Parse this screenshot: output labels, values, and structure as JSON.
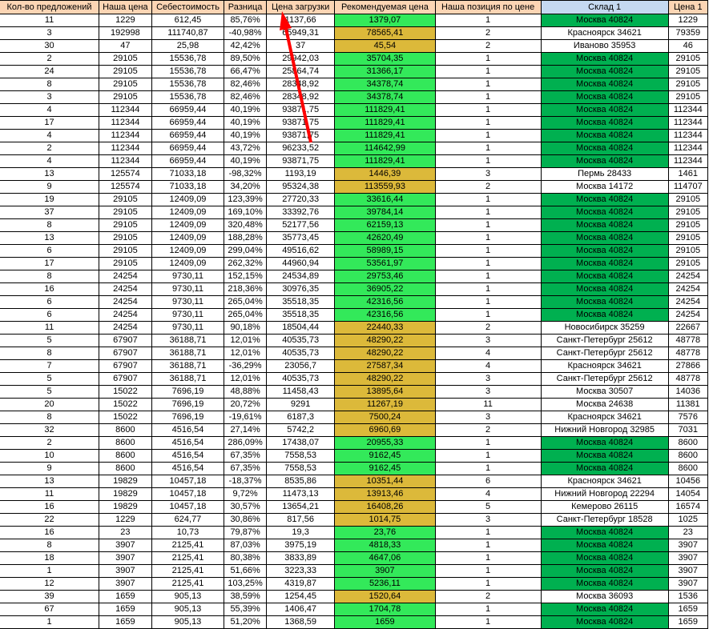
{
  "headers": [
    "Кол-во предложений",
    "Наша цена",
    "Себестоимость",
    "Разница",
    "Цена загрузки",
    "Рекомендуемая цена",
    "Наша позиция по цене",
    "Склад 1",
    "Цена 1"
  ],
  "colors": {
    "header": "#fcd5b4",
    "warehouse_header": "#c5d9f1",
    "recommended_ok": "#33e95a",
    "recommended_warn": "#dcb93a",
    "warehouse_ours": "#00b050",
    "arrow": "#ff0000"
  },
  "rows": [
    [
      "11",
      "1229",
      "612,45",
      "85,76%",
      "1137,66",
      "1379,07",
      "1",
      "Москва 40824",
      "1229"
    ],
    [
      "3",
      "192998",
      "111740,87",
      "-40,98%",
      "65949,31",
      "78565,41",
      "2",
      "Красноярск 34621",
      "79359"
    ],
    [
      "30",
      "47",
      "25,98",
      "42,42%",
      "37",
      "45,54",
      "2",
      "Иваново 35953",
      "46"
    ],
    [
      "2",
      "29105",
      "15536,78",
      "89,50%",
      "29942,03",
      "35704,35",
      "1",
      "Москва 40824",
      "29105"
    ],
    [
      "24",
      "29105",
      "15536,78",
      "66,47%",
      "25864,74",
      "31366,17",
      "1",
      "Москва 40824",
      "29105"
    ],
    [
      "8",
      "29105",
      "15536,78",
      "82,46%",
      "28348,92",
      "34378,74",
      "1",
      "Москва 40824",
      "29105"
    ],
    [
      "3",
      "29105",
      "15536,78",
      "82,46%",
      "28348,92",
      "34378,74",
      "1",
      "Москва 40824",
      "29105"
    ],
    [
      "4",
      "112344",
      "66959,44",
      "40,19%",
      "93871,75",
      "111829,41",
      "1",
      "Москва 40824",
      "112344"
    ],
    [
      "17",
      "112344",
      "66959,44",
      "40,19%",
      "93871,75",
      "111829,41",
      "1",
      "Москва 40824",
      "112344"
    ],
    [
      "4",
      "112344",
      "66959,44",
      "40,19%",
      "93871,75",
      "111829,41",
      "1",
      "Москва 40824",
      "112344"
    ],
    [
      "2",
      "112344",
      "66959,44",
      "43,72%",
      "96233,52",
      "114642,99",
      "1",
      "Москва 40824",
      "112344"
    ],
    [
      "4",
      "112344",
      "66959,44",
      "40,19%",
      "93871,75",
      "111829,41",
      "1",
      "Москва 40824",
      "112344"
    ],
    [
      "13",
      "125574",
      "71033,18",
      "-98,32%",
      "1193,19",
      "1446,39",
      "3",
      "Пермь 28433",
      "1461"
    ],
    [
      "9",
      "125574",
      "71033,18",
      "34,20%",
      "95324,38",
      "113559,93",
      "2",
      "Москва 14172",
      "114707"
    ],
    [
      "19",
      "29105",
      "12409,09",
      "123,39%",
      "27720,33",
      "33616,44",
      "1",
      "Москва 40824",
      "29105"
    ],
    [
      "37",
      "29105",
      "12409,09",
      "169,10%",
      "33392,76",
      "39784,14",
      "1",
      "Москва 40824",
      "29105"
    ],
    [
      "8",
      "29105",
      "12409,09",
      "320,48%",
      "52177,56",
      "62159,13",
      "1",
      "Москва 40824",
      "29105"
    ],
    [
      "13",
      "29105",
      "12409,09",
      "188,28%",
      "35773,45",
      "42620,49",
      "1",
      "Москва 40824",
      "29105"
    ],
    [
      "6",
      "29105",
      "12409,09",
      "299,04%",
      "49516,62",
      "58989,15",
      "1",
      "Москва 40824",
      "29105"
    ],
    [
      "17",
      "29105",
      "12409,09",
      "262,32%",
      "44960,94",
      "53561,97",
      "1",
      "Москва 40824",
      "29105"
    ],
    [
      "8",
      "24254",
      "9730,11",
      "152,15%",
      "24534,89",
      "29753,46",
      "1",
      "Москва 40824",
      "24254"
    ],
    [
      "16",
      "24254",
      "9730,11",
      "218,36%",
      "30976,35",
      "36905,22",
      "1",
      "Москва 40824",
      "24254"
    ],
    [
      "6",
      "24254",
      "9730,11",
      "265,04%",
      "35518,35",
      "42316,56",
      "1",
      "Москва 40824",
      "24254"
    ],
    [
      "6",
      "24254",
      "9730,11",
      "265,04%",
      "35518,35",
      "42316,56",
      "1",
      "Москва 40824",
      "24254"
    ],
    [
      "11",
      "24254",
      "9730,11",
      "90,18%",
      "18504,44",
      "22440,33",
      "2",
      "Новосибирск 35259",
      "22667"
    ],
    [
      "5",
      "67907",
      "36188,71",
      "12,01%",
      "40535,73",
      "48290,22",
      "3",
      "Санкт-Петербург 25612",
      "48778"
    ],
    [
      "8",
      "67907",
      "36188,71",
      "12,01%",
      "40535,73",
      "48290,22",
      "4",
      "Санкт-Петербург 25612",
      "48778"
    ],
    [
      "7",
      "67907",
      "36188,71",
      "-36,29%",
      "23056,7",
      "27587,34",
      "4",
      "Красноярск 34621",
      "27866"
    ],
    [
      "5",
      "67907",
      "36188,71",
      "12,01%",
      "40535,73",
      "48290,22",
      "3",
      "Санкт-Петербург 25612",
      "48778"
    ],
    [
      "5",
      "15022",
      "7696,19",
      "48,88%",
      "11458,43",
      "13895,64",
      "3",
      "Москва 30507",
      "14036"
    ],
    [
      "20",
      "15022",
      "7696,19",
      "20,72%",
      "9291",
      "11267,19",
      "11",
      "Москва 24638",
      "11381"
    ],
    [
      "8",
      "15022",
      "7696,19",
      "-19,61%",
      "6187,3",
      "7500,24",
      "3",
      "Красноярск 34621",
      "7576"
    ],
    [
      "32",
      "8600",
      "4516,54",
      "27,14%",
      "5742,2",
      "6960,69",
      "2",
      "Нижний Новгород 32985",
      "7031"
    ],
    [
      "2",
      "8600",
      "4516,54",
      "286,09%",
      "17438,07",
      "20955,33",
      "1",
      "Москва 40824",
      "8600"
    ],
    [
      "10",
      "8600",
      "4516,54",
      "67,35%",
      "7558,53",
      "9162,45",
      "1",
      "Москва 40824",
      "8600"
    ],
    [
      "9",
      "8600",
      "4516,54",
      "67,35%",
      "7558,53",
      "9162,45",
      "1",
      "Москва 40824",
      "8600"
    ],
    [
      "13",
      "19829",
      "10457,18",
      "-18,37%",
      "8535,86",
      "10351,44",
      "6",
      "Красноярск 34621",
      "10456"
    ],
    [
      "11",
      "19829",
      "10457,18",
      "9,72%",
      "11473,13",
      "13913,46",
      "4",
      "Нижний Новгород 22294",
      "14054"
    ],
    [
      "16",
      "19829",
      "10457,18",
      "30,57%",
      "13654,21",
      "16408,26",
      "5",
      "Кемерово 26115",
      "16574"
    ],
    [
      "22",
      "1229",
      "624,77",
      "30,86%",
      "817,56",
      "1014,75",
      "3",
      "Санкт-Петербург 18528",
      "1025"
    ],
    [
      "16",
      "23",
      "10,73",
      "79,87%",
      "19,3",
      "23,76",
      "1",
      "Москва 40824",
      "23"
    ],
    [
      "8",
      "3907",
      "2125,41",
      "87,03%",
      "3975,19",
      "4818,33",
      "1",
      "Москва 40824",
      "3907"
    ],
    [
      "18",
      "3907",
      "2125,41",
      "80,38%",
      "3833,89",
      "4647,06",
      "1",
      "Москва 40824",
      "3907"
    ],
    [
      "1",
      "3907",
      "2125,41",
      "51,66%",
      "3223,33",
      "3907",
      "1",
      "Москва 40824",
      "3907"
    ],
    [
      "12",
      "3907",
      "2125,41",
      "103,25%",
      "4319,87",
      "5236,11",
      "1",
      "Москва 40824",
      "3907"
    ],
    [
      "39",
      "1659",
      "905,13",
      "38,59%",
      "1254,45",
      "1520,64",
      "2",
      "Москва 36093",
      "1536"
    ],
    [
      "67",
      "1659",
      "905,13",
      "55,39%",
      "1406,47",
      "1704,78",
      "1",
      "Москва 40824",
      "1659"
    ],
    [
      "1",
      "1659",
      "905,13",
      "51,20%",
      "1368,59",
      "1659",
      "1",
      "Москва 40824",
      "1659"
    ]
  ]
}
